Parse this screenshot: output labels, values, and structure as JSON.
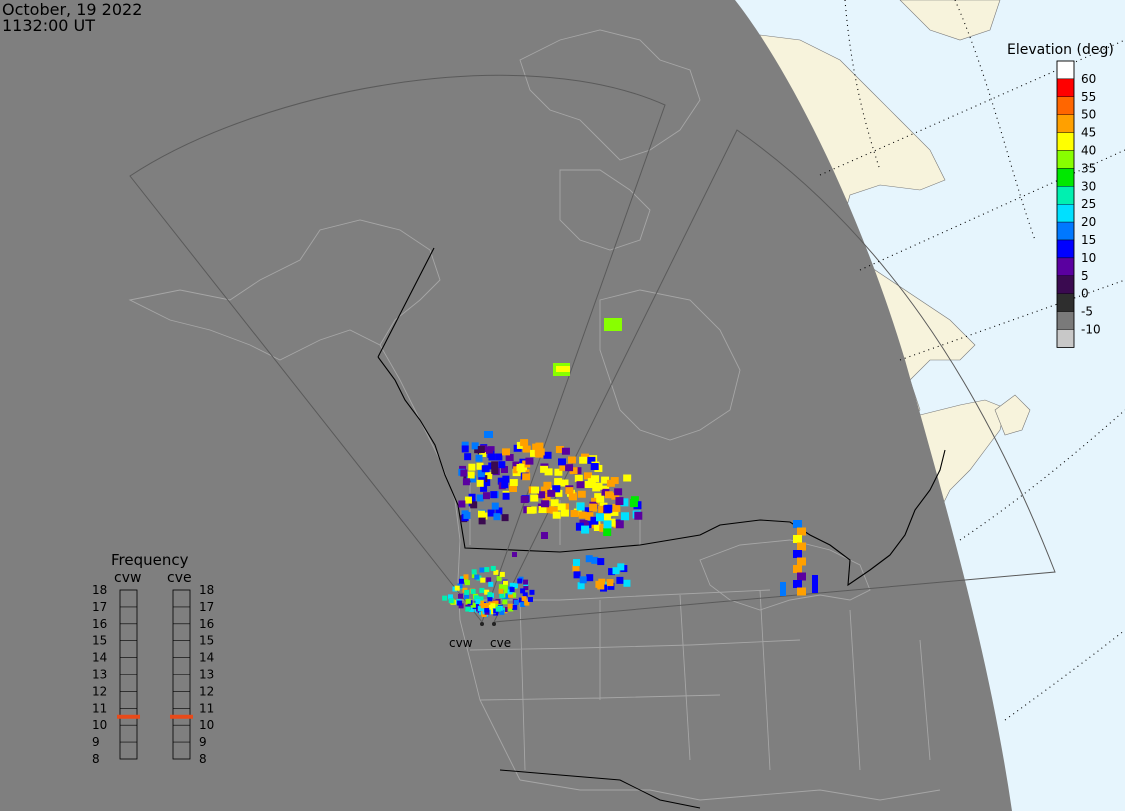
{
  "header": {
    "date": "October, 19 2022",
    "time": "1132:00 UT"
  },
  "colors": {
    "night_fill": "#7f7f7f",
    "ocean_fill": "#e6f5fd",
    "land_fill": "#f7f3dc",
    "border_line": "#9a9a9a",
    "frequency_marker": "#e84a1a"
  },
  "radars": [
    {
      "code": "cvw"
    },
    {
      "code": "cve"
    }
  ],
  "elevation_legend": {
    "title": "Elevation (deg)",
    "levels": [
      {
        "label": "60",
        "color": "#ff0000"
      },
      {
        "label": "55",
        "color": "#ff6600"
      },
      {
        "label": "50",
        "color": "#ffa000"
      },
      {
        "label": "45",
        "color": "#ffff00"
      },
      {
        "label": "40",
        "color": "#88ff00"
      },
      {
        "label": "35",
        "color": "#00e800"
      },
      {
        "label": "30",
        "color": "#00f0b0"
      },
      {
        "label": "25",
        "color": "#00e0ff"
      },
      {
        "label": "20",
        "color": "#0078ff"
      },
      {
        "label": "15",
        "color": "#0000ff"
      },
      {
        "label": "10",
        "color": "#5a00a0"
      },
      {
        "label": "5",
        "color": "#3a0a50"
      },
      {
        "label": "0",
        "color": "#2e2e2e"
      },
      {
        "label": "-5",
        "color": "#7a7a7a"
      },
      {
        "label": "-10",
        "color": "#c8c8c8"
      }
    ]
  },
  "frequency_panel": {
    "title": "Frequency",
    "columns": [
      "cvw",
      "cve"
    ],
    "levels": [
      "18",
      "17",
      "16",
      "15",
      "14",
      "13",
      "12",
      "11",
      "10",
      "9",
      "8"
    ],
    "selected_mhz": [
      10.5,
      10.5
    ]
  }
}
